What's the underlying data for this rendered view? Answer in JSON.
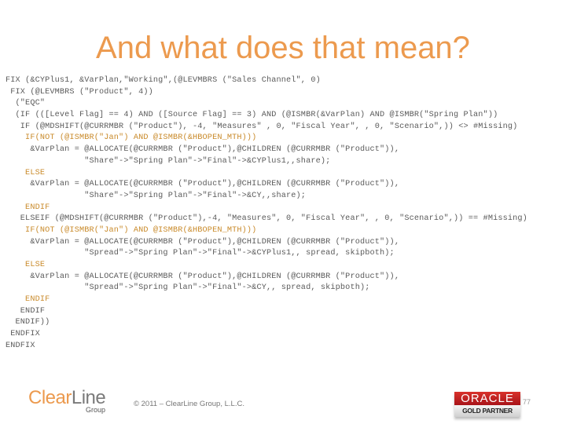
{
  "slide": {
    "title": "And what does that mean?",
    "code_lines": [
      {
        "text": "FIX (&CYPlus1, &VarPlan,\"Working\",(@LEVMBRS (\"Sales Channel\", 0)",
        "highlight": false
      },
      {
        "text": " FIX (@LEVMBRS (\"Product\", 4))",
        "highlight": false
      },
      {
        "text": "  (\"EQC\"",
        "highlight": false
      },
      {
        "text": "  (IF (([Level Flag] == 4) AND ([Source Flag] == 3) AND (@ISMBR(&VarPlan) AND @ISMBR(\"Spring Plan\"))",
        "highlight": false
      },
      {
        "text": "   IF (@MDSHIFT(@CURRMBR (\"Product\"), -4, \"Measures\" , 0, \"Fiscal Year\", , 0, \"Scenario\",)) <> #Missing)",
        "highlight": false
      },
      {
        "text": "    IF(NOT (@ISMBR(\"Jan\") AND @ISMBR(&HBOPEN_MTH)))",
        "highlight": true
      },
      {
        "text": "     &VarPlan = @ALLOCATE(@CURRMBR (\"Product\"),@CHILDREN (@CURRMBR (\"Product\")),",
        "highlight": false
      },
      {
        "text": "                \"Share\"->\"Spring Plan\"->\"Final\"->&CYPlus1,,share);",
        "highlight": false
      },
      {
        "text": "    ELSE",
        "highlight": true
      },
      {
        "text": "     &VarPlan = @ALLOCATE(@CURRMBR (\"Product\"),@CHILDREN (@CURRMBR (\"Product\")),",
        "highlight": false
      },
      {
        "text": "                \"Share\"->\"Spring Plan\"->\"Final\"->&CY,,share);",
        "highlight": false
      },
      {
        "text": "    ENDIF",
        "highlight": true
      },
      {
        "text": "   ELSEIF (@MDSHIFT(@CURRMBR (\"Product\"),-4, \"Measures\", 0, \"Fiscal Year\", , 0, \"Scenario\",)) == #Missing)",
        "highlight": false
      },
      {
        "text": "    IF(NOT (@ISMBR(\"Jan\") AND @ISMBR(&HBOPEN_MTH)))",
        "highlight": true
      },
      {
        "text": "     &VarPlan = @ALLOCATE(@CURRMBR (\"Product\"),@CHILDREN (@CURRMBR (\"Product\")),",
        "highlight": false
      },
      {
        "text": "                \"Spread\"->\"Spring Plan\"->\"Final\"->&CYPlus1,, spread, skipboth);",
        "highlight": false
      },
      {
        "text": "    ELSE",
        "highlight": true
      },
      {
        "text": "     &VarPlan = @ALLOCATE(@CURRMBR (\"Product\"),@CHILDREN (@CURRMBR (\"Product\")),",
        "highlight": false
      },
      {
        "text": "                \"Spread\"->\"Spring Plan\"->\"Final\"->&CY,, spread, skipboth);",
        "highlight": false
      },
      {
        "text": "    ENDIF",
        "highlight": true
      },
      {
        "text": "   ENDIF",
        "highlight": false
      },
      {
        "text": "  ENDIF))",
        "highlight": false
      },
      {
        "text": " ENDFIX",
        "highlight": false
      },
      {
        "text": "ENDFIX",
        "highlight": false
      }
    ]
  },
  "footer": {
    "logo_main": "Clear",
    "logo_accent": "Line",
    "logo_sub": "Group",
    "copyright": "© 2011 – ClearLine Group, L.L.C.",
    "badge_top": "ORACLE",
    "badge_bottom": "GOLD PARTNER",
    "page_number": "77"
  },
  "colors": {
    "title": "#ec9a4e",
    "code_text": "#5a5a5a",
    "code_highlight": "#c98a2a",
    "oracle_red": "#c4221f"
  }
}
